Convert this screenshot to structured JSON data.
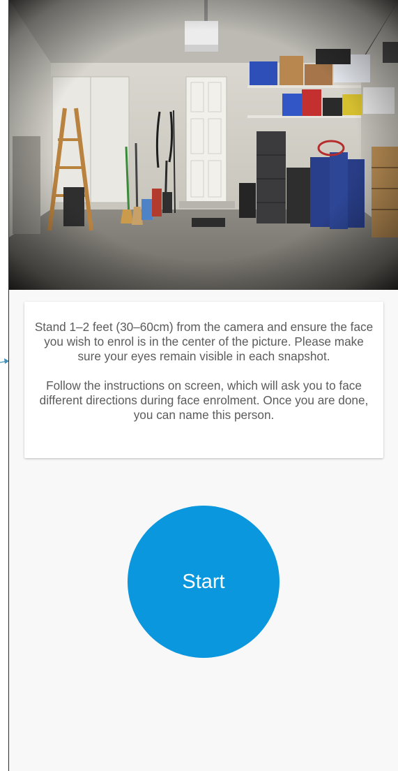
{
  "camera": {
    "scene": "garage-camera-preview"
  },
  "instructions": {
    "paragraph1": "Stand 1–2 feet (30–60cm) from the camera and ensure the face you wish to enrol is in the center of the picture. Please make sure your eyes remain visible in each snapshot.",
    "paragraph2": "Follow the instructions on screen, which will ask you to face different directions during face enrolment. Once you are done, you can name this person."
  },
  "start_button": {
    "label": "Start"
  },
  "colors": {
    "accent": "#0a97de",
    "background": "#f8f8f8",
    "card": "#ffffff",
    "text": "#5b5b5b",
    "pointer": "#3f8fb8"
  },
  "icons": {
    "pointer": "arrow-right-icon"
  }
}
